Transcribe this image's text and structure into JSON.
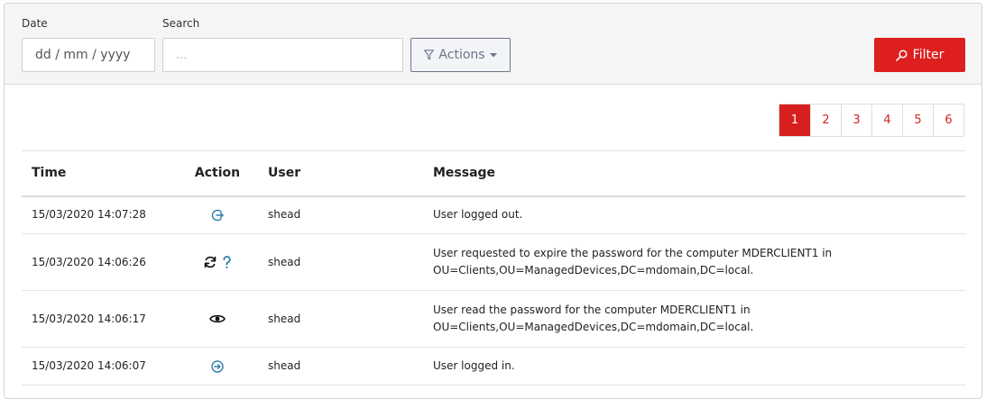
{
  "filters": {
    "date_label": "Date",
    "date_placeholder": "dd / mm / yyyy",
    "search_label": "Search",
    "search_placeholder": "...",
    "actions_label": "Actions",
    "filter_label": "Filter"
  },
  "pagination": {
    "pages": [
      "1",
      "2",
      "3",
      "4",
      "5",
      "6"
    ],
    "active": "1"
  },
  "table": {
    "headers": {
      "time": "Time",
      "action": "Action",
      "user": "User",
      "message": "Message"
    },
    "rows": [
      {
        "time": "15/03/2020 14:07:28",
        "action_icons": [
          "logout-icon"
        ],
        "user": "shead",
        "message_lines": [
          "User logged out."
        ]
      },
      {
        "time": "15/03/2020 14:06:26",
        "action_icons": [
          "refresh-icon",
          "question-mark-icon"
        ],
        "user": "shead",
        "message_lines": [
          "User requested to expire the password for the computer MDERCLIENT1 in",
          "OU=Clients,OU=ManagedDevices,DC=mdomain,DC=local."
        ]
      },
      {
        "time": "15/03/2020 14:06:17",
        "action_icons": [
          "eye-icon"
        ],
        "user": "shead",
        "message_lines": [
          "User read the password for the computer MDERCLIENT1 in",
          "OU=Clients,OU=ManagedDevices,DC=mdomain,DC=local."
        ]
      },
      {
        "time": "15/03/2020 14:06:07",
        "action_icons": [
          "login-icon"
        ],
        "user": "shead",
        "message_lines": [
          "User logged in."
        ]
      }
    ]
  },
  "colors": {
    "accent_red": "#dd1f1f",
    "icon_blue": "#2f7fa8",
    "actions_gray": "#6c7588"
  }
}
